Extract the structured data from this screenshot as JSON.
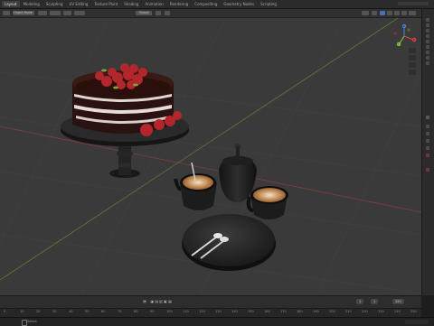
{
  "topbar": {
    "tabs": [
      "Layout",
      "Modeling",
      "Sculpting",
      "UV Editing",
      "Texture Paint",
      "Shading",
      "Animation",
      "Rendering",
      "Compositing",
      "Geometry Nodes",
      "Scripting"
    ],
    "active_tab": 0
  },
  "header": {
    "mode_label": "Object Mode",
    "orientation_label": "Global",
    "options_label": "Options"
  },
  "gizmo": {
    "x_label": "X",
    "y_label": "Y",
    "z_label": "Z"
  },
  "timeline": {
    "current_frame": "1",
    "start_frame": "1",
    "end_frame": "250",
    "ruler_ticks": [
      "0",
      "10",
      "20",
      "30",
      "40",
      "50",
      "60",
      "70",
      "80",
      "90",
      "100",
      "110",
      "120",
      "130",
      "140",
      "150",
      "160",
      "170",
      "180",
      "190",
      "200",
      "210",
      "220",
      "230",
      "240",
      "250"
    ]
  },
  "status": {
    "left_label": "Select"
  },
  "colors": {
    "viewport_bg": "#3a3a3a",
    "accent": "#4772b3",
    "x_axis": "#e0434b",
    "y_axis": "#8cc43d",
    "z_axis": "#4584e0"
  }
}
